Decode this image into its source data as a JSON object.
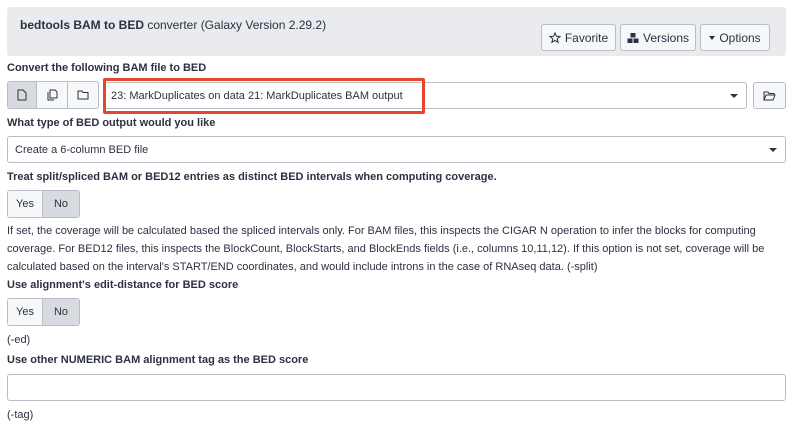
{
  "header": {
    "title_bold": "bedtools BAM to BED",
    "title_rest": " converter (Galaxy Version 2.29.2)",
    "favorite_label": "Favorite",
    "versions_label": "Versions",
    "options_label": "Options"
  },
  "input_file": {
    "label": "Convert the following BAM file to BED",
    "selected": "23: MarkDuplicates on data 21: MarkDuplicates BAM output"
  },
  "bed_type": {
    "label": "What type of BED output would you like",
    "selected": "Create a 6-column BED file"
  },
  "split": {
    "label": "Treat split/spliced BAM or BED12 entries as distinct BED intervals when computing coverage.",
    "yes": "Yes",
    "no": "No",
    "help_line1": "If set, the coverage will be calculated based the spliced intervals only. For BAM files, this inspects the CIGAR N operation to infer the blocks for computing",
    "help_line2": "coverage. For BED12 files, this inspects the BlockCount, BlockStarts, and BlockEnds fields (i.e., columns 10,11,12). If this option is not set, coverage will be",
    "help_line3": "calculated based on the interval's START/END coordinates, and would include introns in the case of RNAseq data. (-split)"
  },
  "edit_distance": {
    "label": "Use alignment's edit-distance for BED score",
    "yes": "Yes",
    "no": "No",
    "help": "(-ed)"
  },
  "tag": {
    "label": "Use other NUMERIC BAM alignment tag as the BED score",
    "value": "",
    "help": "(-tag)"
  }
}
